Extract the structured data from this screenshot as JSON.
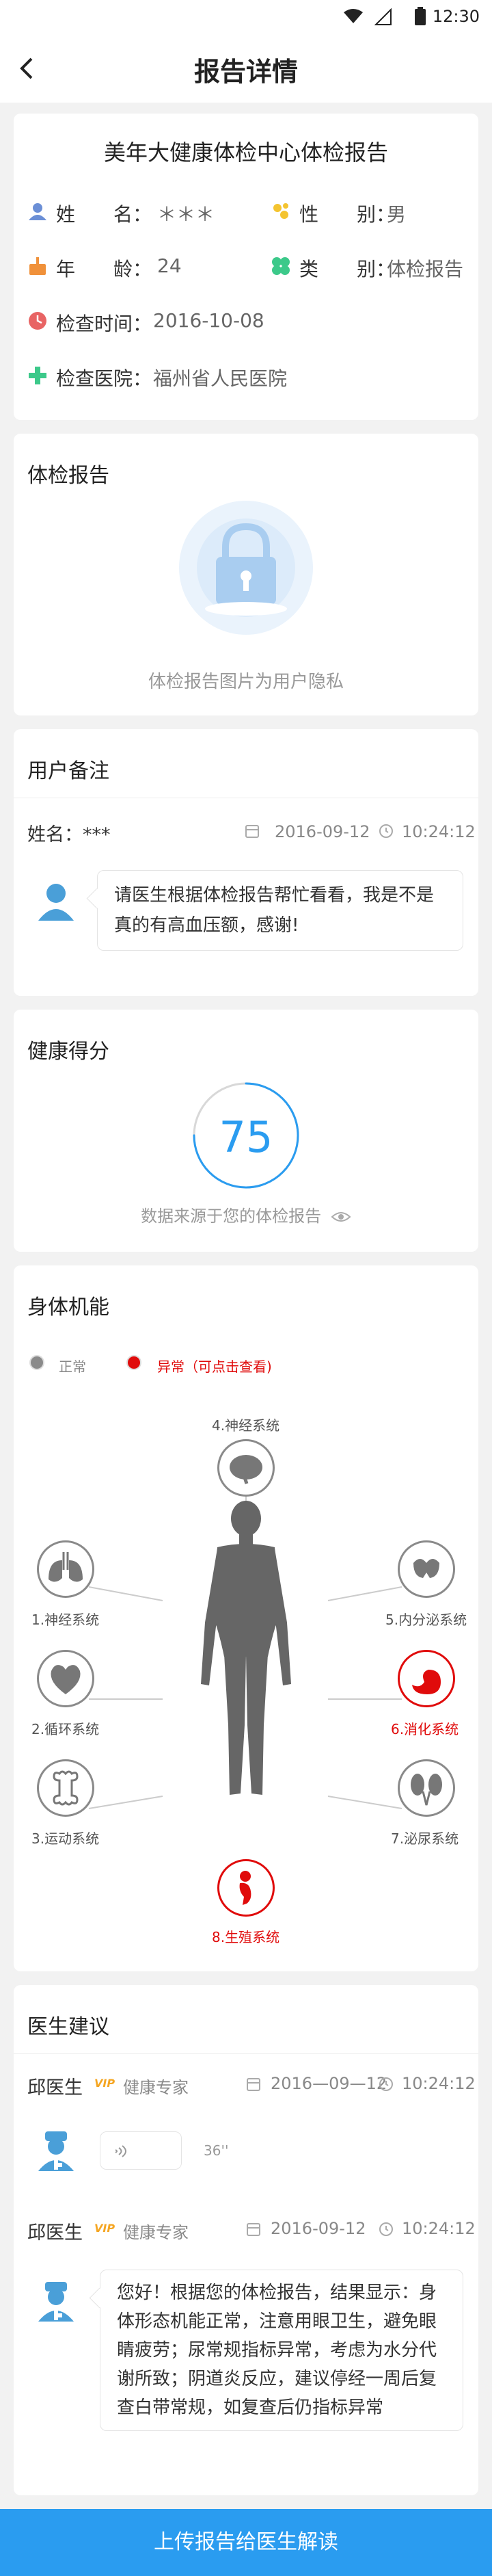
{
  "status": {
    "time": "12:30"
  },
  "nav": {
    "title": "报告详情"
  },
  "info": {
    "title": "美年大健康体检中心体检报告",
    "name_label": "姓　　名：",
    "name_value": "＊＊＊",
    "gender_label": "性　　别：",
    "gender_value": "男",
    "age_label": "年　　龄：",
    "age_value": "24",
    "type_label": "类　　别：",
    "type_value": "体检报告",
    "time_label": "检查时间：",
    "time_value": "2016-10-08",
    "hospital_label": "检查医院：",
    "hospital_value": "福州省人民医院"
  },
  "report": {
    "title": "体检报告",
    "privacy_text": "体检报告图片为用户隐私"
  },
  "remarks": {
    "title": "用户备注",
    "user": "姓名：***",
    "date": "2016-09-12",
    "time": "10:24:12",
    "message": "请医生根据体检报告帮忙看看，我是不是真的有高血压额，感谢!"
  },
  "score": {
    "title": "健康得分",
    "value": "75",
    "value_pct": 75,
    "source_text": "数据来源于您的体检报告"
  },
  "body": {
    "title": "身体机能",
    "legend_normal": "正常",
    "legend_abnormal": "异常（可点击查看)",
    "organs": {
      "top": "4.神经系统",
      "l1": "1.神经系统",
      "l2": "2.循环系统",
      "l3": "3.运动系统",
      "r1": "5.内分泌系统",
      "r2": "6.消化系统",
      "r3": "7.泌尿系统",
      "bottom": "8.生殖系统"
    },
    "colors": {
      "normal": "#8a8a8a",
      "abnormal": "#e00b0b"
    }
  },
  "advice": {
    "title": "医生建议",
    "doctor1": {
      "name": "邱医生",
      "vip": "VIP",
      "role": "健康专家",
      "date": "2016—09—12",
      "time": "10:24:12",
      "voice": "36''"
    },
    "doctor2": {
      "name": "邱医生",
      "vip": "VIP",
      "role": "健康专家",
      "date": "2016-09-12",
      "time": "10:24:12",
      "message": "您好！根据您的体检报告，结果显示：身体形态机能正常，注意用眼卫生，避免眼睛疲劳；尿常规指标异常，考虑为水分代谢所致；阴道炎反应，建议停经一周后复查白带常规，如复查后仍指标异常"
    }
  },
  "cta": {
    "label": "上传报告给医生解读"
  },
  "colors": {
    "accent": "#2a9cf0",
    "abnormal": "#e00b0b"
  }
}
